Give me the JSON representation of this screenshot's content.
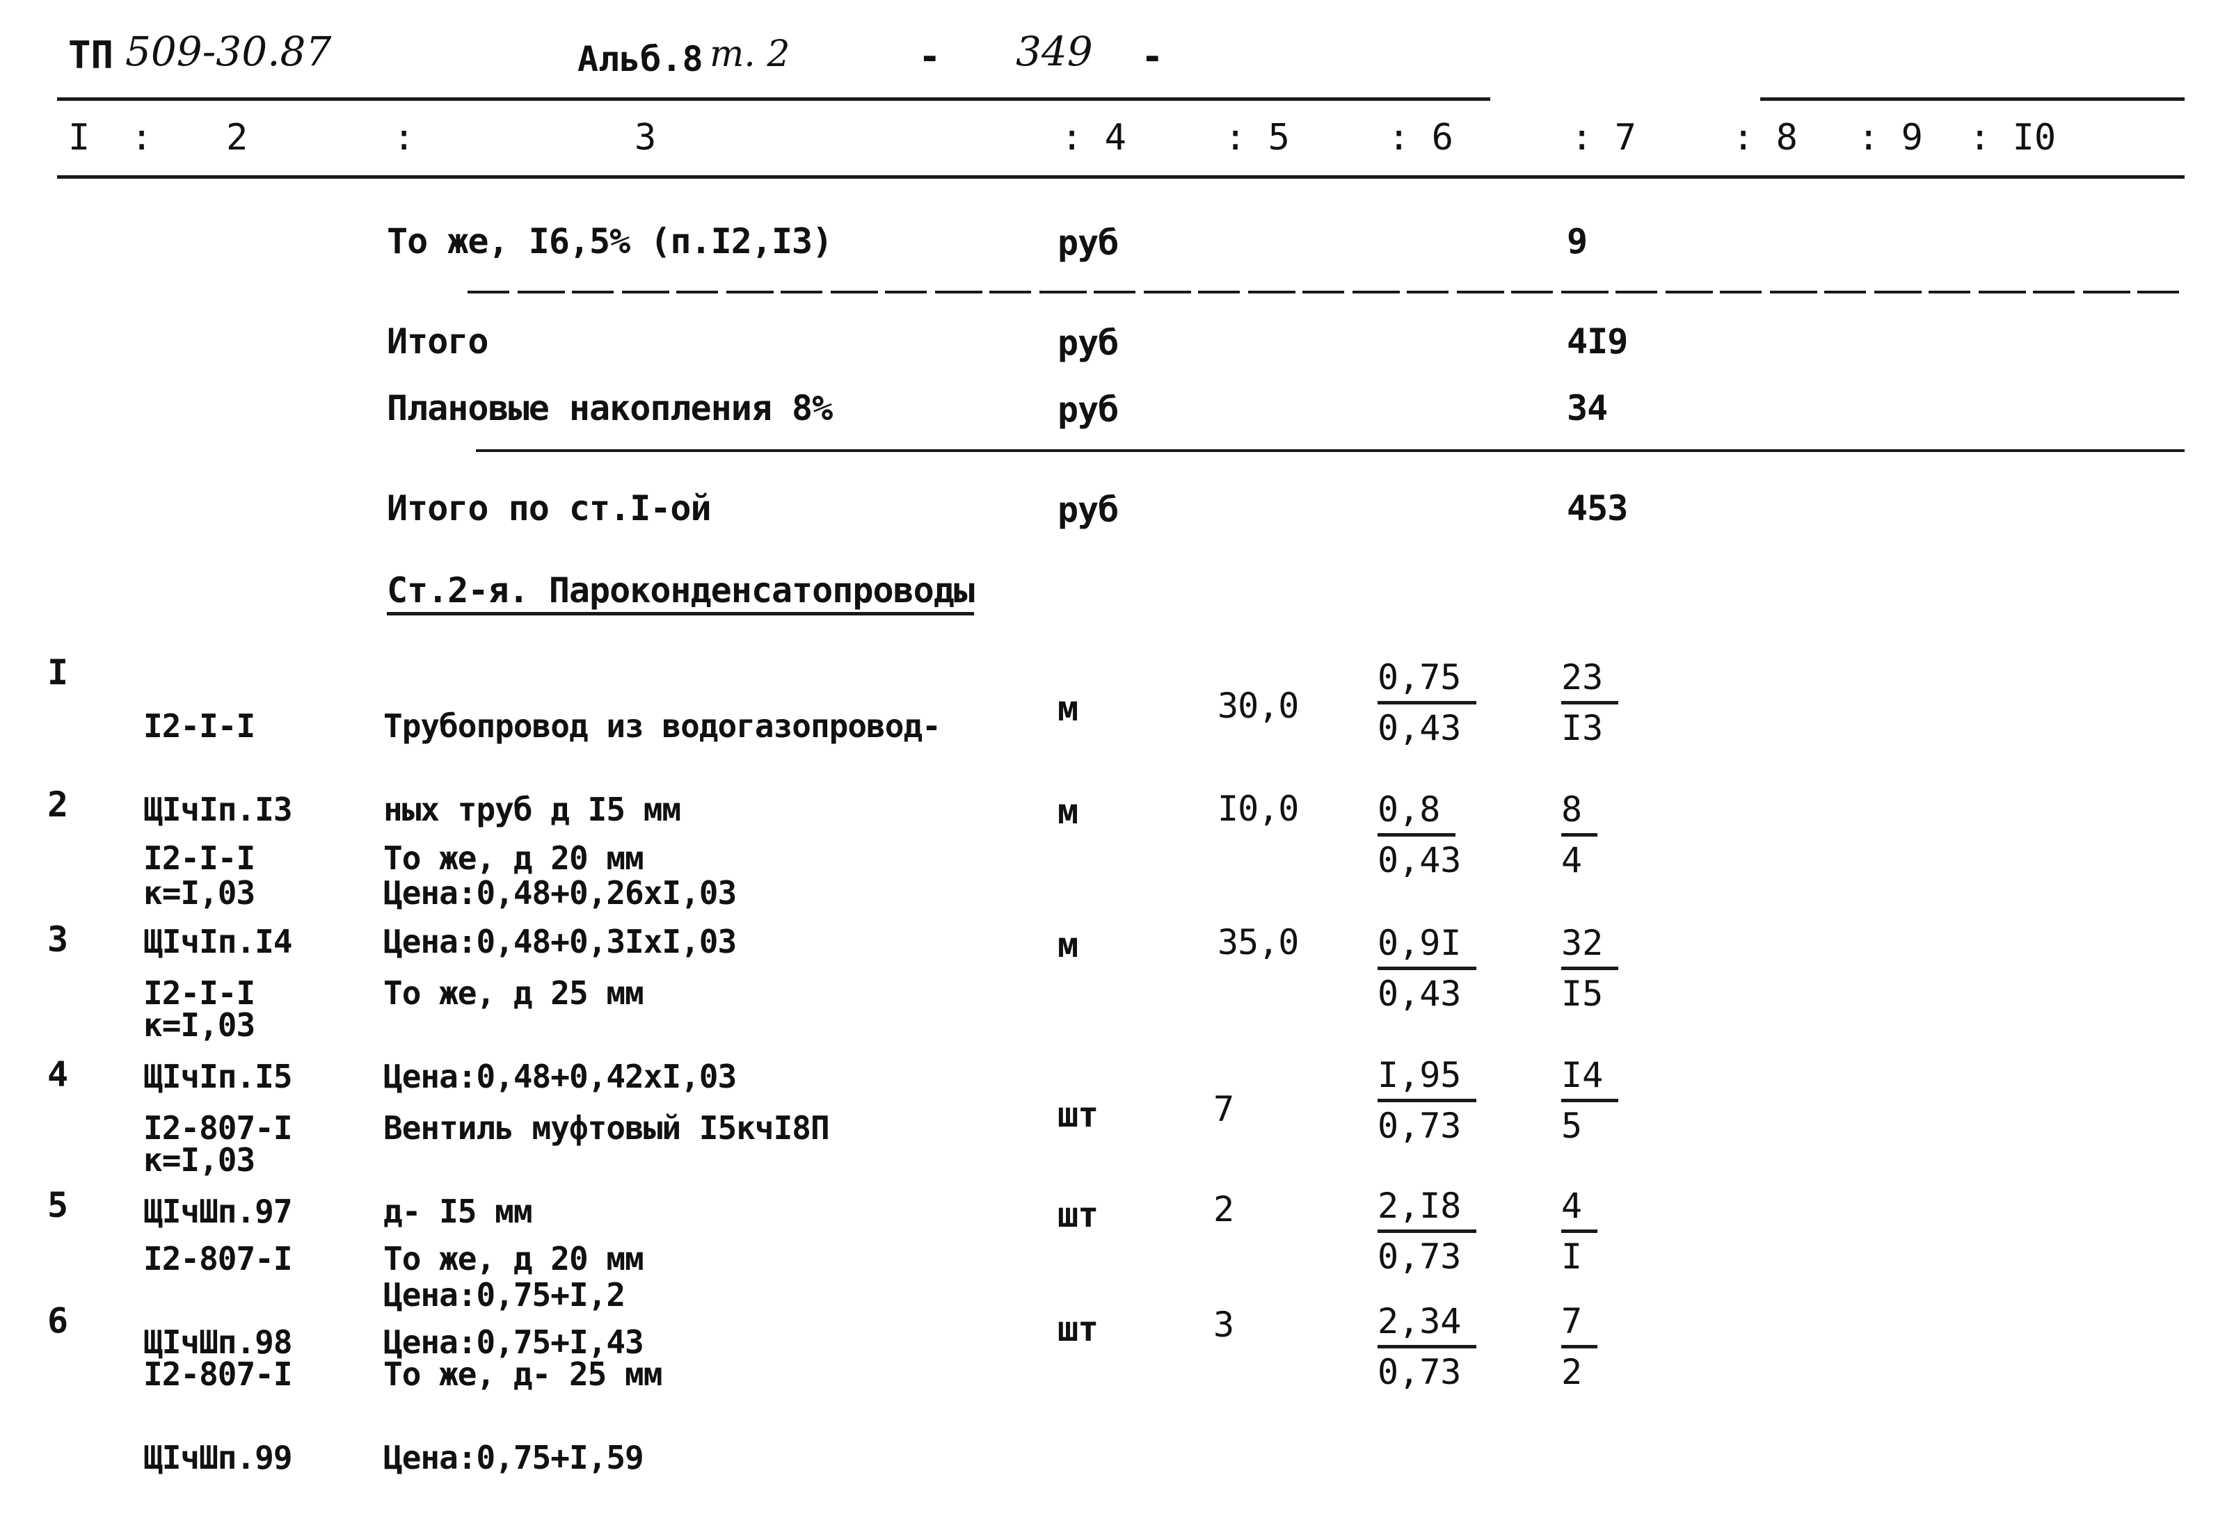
{
  "header": {
    "tp_label": "ТП",
    "tp_number": "509-30.87",
    "album_label": "Альб.8",
    "volume": "т. 2",
    "dash_left": "-",
    "page_number": "349",
    "dash_right": "-"
  },
  "column_headers": [
    "I",
    ":",
    "2",
    ":",
    "3",
    ": 4",
    ": 5",
    ": 6",
    ": 7",
    ": 8",
    ": 9",
    ": I0"
  ],
  "summary_rows": [
    {
      "name": "То же, I6,5% (п.I2,I3)",
      "unit": "руб",
      "total": "9"
    },
    {
      "name": "Итого",
      "unit": "руб",
      "total": "4I9"
    },
    {
      "name": "Плановые накопления 8%",
      "unit": "руб",
      "total": "34"
    },
    {
      "name": "Итого по ст.I-ой",
      "unit": "руб",
      "total": "453"
    }
  ],
  "section_title": "Ст.2-я. Пароконденсатопроводы",
  "items": [
    {
      "num": "I",
      "code": [
        "I2-I-I",
        "ЩIчIп.I3",
        "к=I,03"
      ],
      "desc": [
        "Трубопровод из водогазопровод-",
        "ных труб д I5 мм",
        "Цена:0,48+0,26хI,03"
      ],
      "unit": "м",
      "qty": "30,0",
      "unit_price": "0,75",
      "unit_wage": "0,43",
      "total": "23",
      "total_wage": "I3"
    },
    {
      "num": "2",
      "code": [
        "I2-I-I",
        "ЩIчIп.I4",
        "к=I,03"
      ],
      "desc": [
        "То же, д 20 мм",
        "Цена:0,48+0,3IхI,03"
      ],
      "unit": "м",
      "qty": "I0,0",
      "unit_price": "0,8",
      "unit_wage": "0,43",
      "total": "8",
      "total_wage": "4"
    },
    {
      "num": "3",
      "code": [
        "I2-I-I",
        "ЩIчIп.I5",
        "к=I,03"
      ],
      "desc": [
        "То же, д 25 мм",
        "Цена:0,48+0,42хI,03"
      ],
      "unit": "м",
      "qty": "35,0",
      "unit_price": "0,9I",
      "unit_wage": "0,43",
      "total": "32",
      "total_wage": "I5"
    },
    {
      "num": "4",
      "code": [
        "I2-807-I",
        "ЩIчШп.97"
      ],
      "desc": [
        "Вентиль муфтовый I5кчI8П",
        "д- I5 мм",
        "Цена:0,75+I,2"
      ],
      "unit": "шт",
      "qty": "7",
      "unit_price": "I,95",
      "unit_wage": "0,73",
      "total": "I4",
      "total_wage": "5"
    },
    {
      "num": "5",
      "code": [
        "I2-807-I",
        "ЩIчШп.98"
      ],
      "desc": [
        "То же, д 20 мм",
        "Цена:0,75+I,43"
      ],
      "unit": "шт",
      "qty": "2",
      "unit_price": "2,I8",
      "unit_wage": "0,73",
      "total": "4",
      "total_wage": "I"
    },
    {
      "num": "6",
      "code": [
        "I2-807-I",
        "ЩIчШп.99"
      ],
      "desc": [
        "То же, д- 25 мм",
        "Цена:0,75+I,59"
      ],
      "unit": "шт",
      "qty": "3",
      "unit_price": "2,34",
      "unit_wage": "0,73",
      "total": "7",
      "total_wage": "2"
    }
  ]
}
